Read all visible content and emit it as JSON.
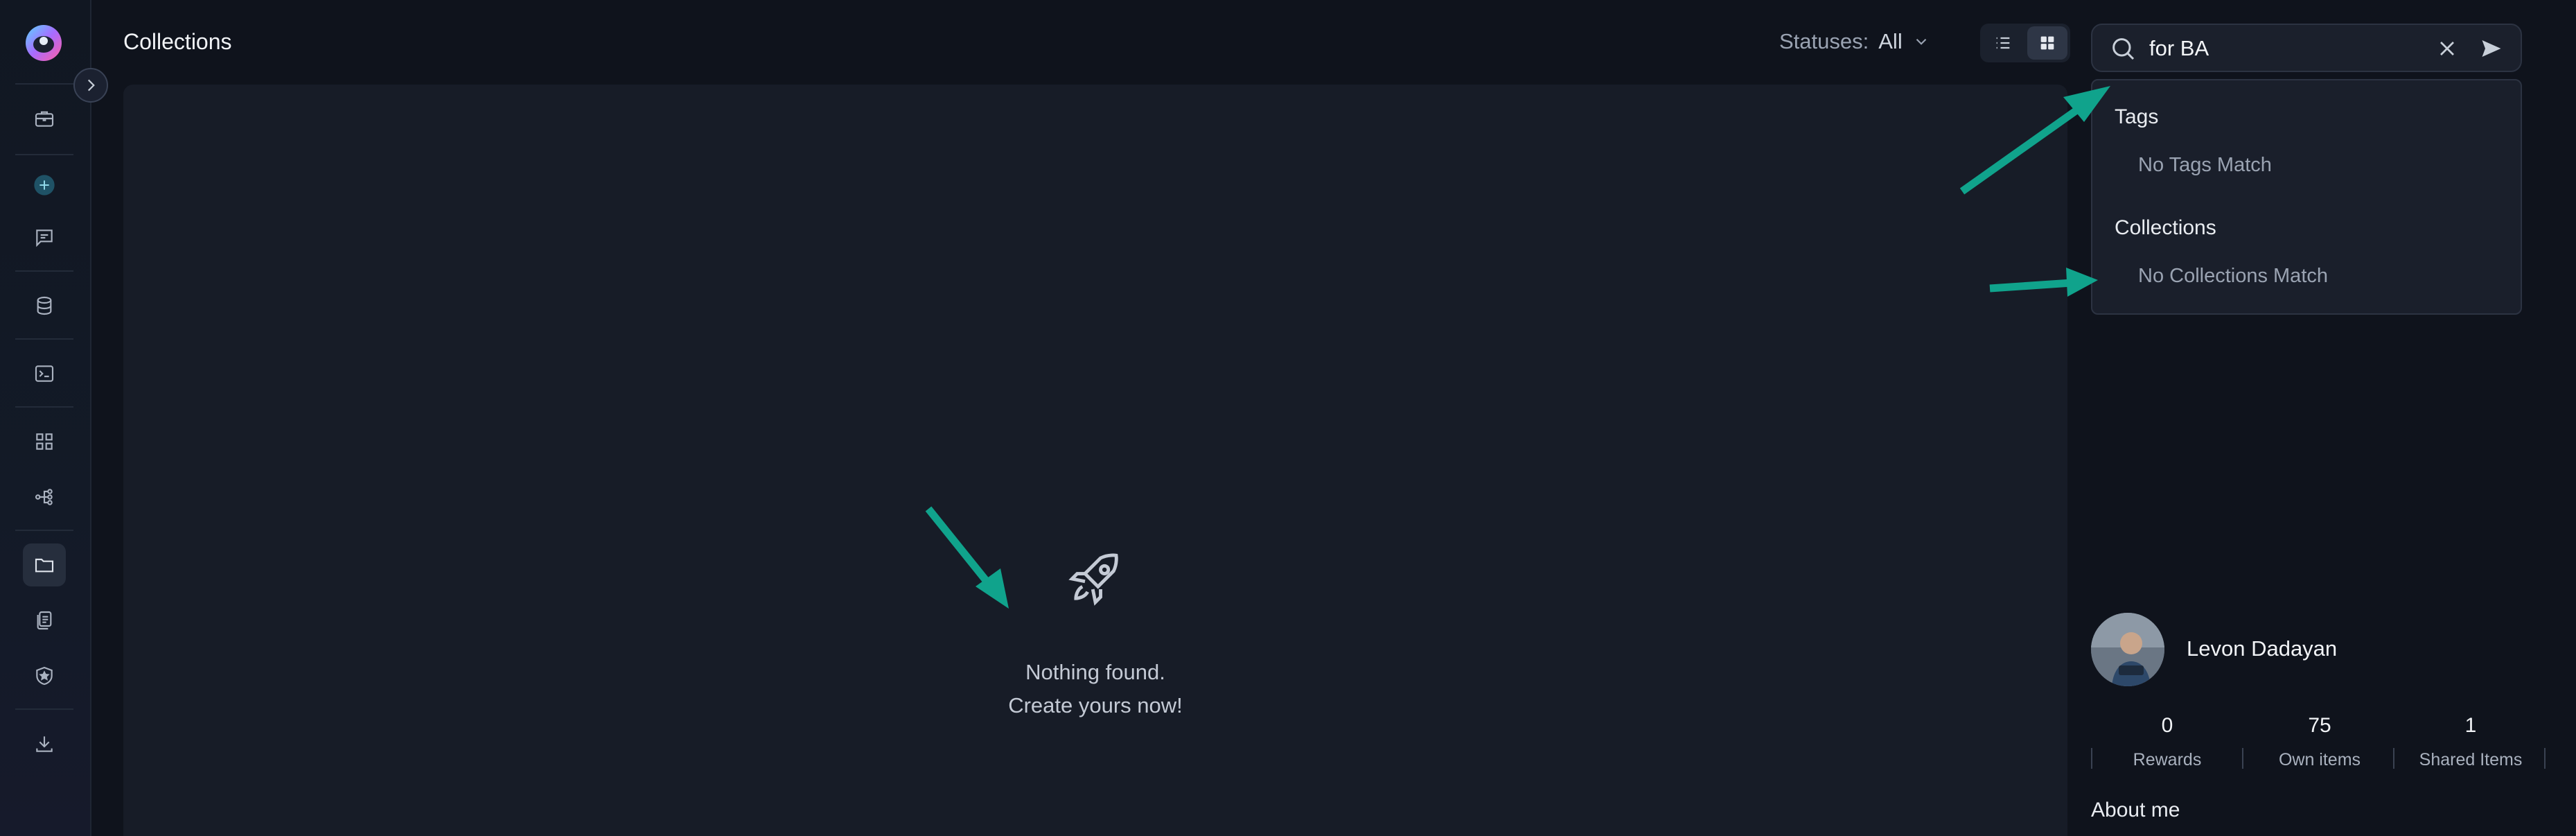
{
  "header": {
    "title": "Collections",
    "statuses_label": "Statuses:",
    "statuses_value": "All"
  },
  "search": {
    "value": "for BA"
  },
  "dropdown": {
    "tags_heading": "Tags",
    "tags_empty": "No Tags Match",
    "collections_heading": "Collections",
    "collections_empty": "No Collections Match"
  },
  "empty_state": {
    "line1": "Nothing found.",
    "line2": "Create yours now!"
  },
  "profile": {
    "name": "Levon Dadayan",
    "stats": [
      {
        "value": "0",
        "label": "Rewards"
      },
      {
        "value": "75",
        "label": "Own items"
      },
      {
        "value": "1",
        "label": "Shared Items"
      }
    ],
    "about_label": "About me"
  },
  "sidebar": {
    "items": [
      "briefcase-icon",
      "plus-icon",
      "chat-icon",
      "database-icon",
      "terminal-icon",
      "grid-icon",
      "workflow-icon",
      "folder-icon",
      "documents-icon",
      "shield-star-icon",
      "download-icon"
    ]
  },
  "colors": {
    "accent_arrow": "#10a38c",
    "background": "#0f131c",
    "panel": "#171c27"
  }
}
